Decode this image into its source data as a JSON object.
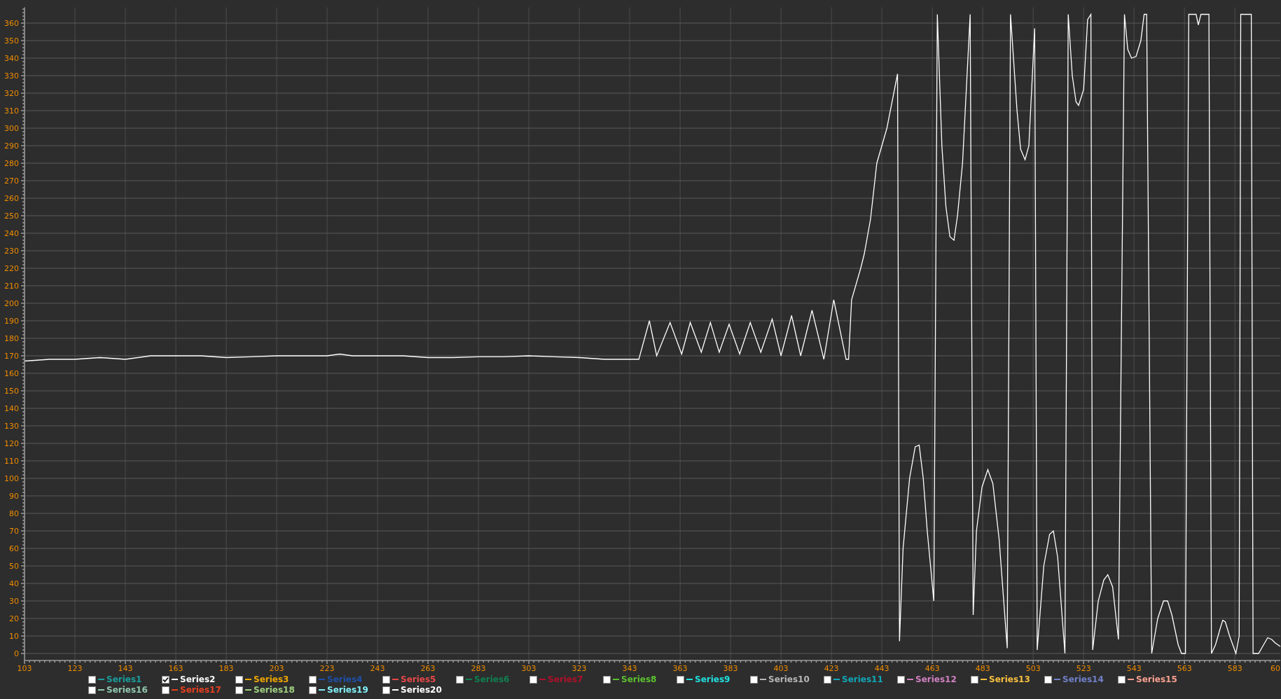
{
  "chart": {
    "chart_data": {
      "type": "line",
      "xlim": [
        103,
        601
      ],
      "grid": true,
      "ylim": [
        -4,
        369
      ],
      "xticks": [
        103,
        123,
        143,
        163,
        183,
        203,
        223,
        243,
        263,
        283,
        303,
        323,
        343,
        363,
        383,
        403,
        423,
        443,
        463,
        483,
        503,
        523,
        543,
        563,
        583
      ],
      "yticks": [
        0,
        10,
        20,
        30,
        40,
        50,
        60,
        70,
        80,
        90,
        100,
        110,
        120,
        130,
        140,
        150,
        160,
        170,
        180,
        190,
        200,
        210,
        220,
        230,
        240,
        250,
        260,
        270,
        280,
        290,
        300,
        310,
        320,
        330,
        340,
        350,
        360
      ],
      "x": [
        103,
        113,
        123,
        133,
        143,
        153,
        163,
        173,
        183,
        193,
        203,
        213,
        223,
        228,
        233,
        243,
        253,
        263,
        273,
        283,
        293,
        303,
        313,
        323,
        333,
        343,
        346.6,
        350.8,
        353.7,
        359,
        363.6,
        367,
        371.4,
        375,
        378.5,
        382.4,
        386.6,
        390.8,
        395,
        399.5,
        403,
        407.2,
        410.8,
        415.3,
        420,
        423.9,
        428.8,
        429.8,
        431,
        434.6,
        436,
        438.5,
        441,
        445,
        449.2,
        450,
        451.4,
        454,
        456.2,
        457.8,
        459.4,
        461,
        463.6,
        465,
        466.8,
        468.4,
        470,
        471.6,
        473,
        475,
        478,
        479.2,
        480.5,
        482.7,
        485,
        487,
        489.5,
        492.7,
        494,
        496.6,
        498,
        499.8,
        501.3,
        503.6,
        504.6,
        507.2,
        509.5,
        511,
        512.7,
        515.6,
        516.9,
        518.5,
        520,
        521,
        523,
        524.6,
        525.9,
        526.6,
        528.8,
        531,
        532.6,
        534.5,
        536.8,
        539.2,
        540.5,
        542,
        543.8,
        545.7,
        547,
        548,
        550,
        552.4,
        554.7,
        556.3,
        558,
        560.5,
        561.8,
        563.4,
        564.7,
        567.6,
        568.5,
        569.5,
        572.7,
        573.7,
        575.3,
        577.3,
        578.2,
        579.2,
        580.9,
        583.4,
        584.7,
        585.3,
        589.5,
        590.2,
        592.4,
        594.4,
        596,
        597.6,
        599,
        601
      ],
      "series": [
        {
          "name": "Series2",
          "color": "#ffffff",
          "values": [
            167,
            168,
            168,
            169,
            168,
            170,
            170,
            170,
            169,
            169.5,
            170,
            170,
            170,
            171,
            170,
            170,
            170,
            169,
            169,
            169.5,
            169.5,
            170,
            169.5,
            169,
            168,
            168,
            168,
            190,
            170,
            189,
            171,
            189,
            172,
            189,
            172,
            188,
            171,
            189,
            172,
            191,
            170,
            193,
            170,
            196,
            168,
            202,
            168,
            168,
            202,
            220,
            228,
            248,
            280,
            300,
            331,
            7,
            60,
            100,
            118,
            119,
            100,
            70,
            30,
            365,
            290,
            255,
            238,
            236,
            250,
            280,
            365,
            22,
            70,
            95,
            105,
            97,
            65,
            3,
            365,
            310,
            288,
            282,
            290,
            357,
            2,
            50,
            68,
            70,
            55,
            0,
            365,
            330,
            315,
            313,
            322,
            362,
            365,
            2,
            30,
            42,
            45,
            38,
            8,
            365,
            345,
            340,
            341,
            350,
            365,
            365,
            0,
            20,
            30,
            30,
            22,
            5,
            0,
            0,
            365,
            365,
            359,
            365,
            365,
            0,
            5,
            15,
            19,
            18,
            10,
            0,
            10,
            365,
            365,
            0,
            0,
            5,
            9,
            8,
            6,
            4
          ]
        }
      ]
    },
    "cut_tick_label": "60",
    "legend": [
      {
        "label": "Series1",
        "color": "#1a9e9e",
        "checked": false
      },
      {
        "kind": "plotted",
        "checked": true
      },
      {
        "label": "Series3",
        "color": "#f0a800",
        "checked": false
      },
      {
        "label": "Series4",
        "color": "#1f4fa8",
        "checked": false
      },
      {
        "label": "Series5",
        "color": "#e84848",
        "checked": false
      },
      {
        "label": "Series6",
        "color": "#108050",
        "checked": false
      },
      {
        "label": "Series7",
        "color": "#b0102a",
        "checked": false
      },
      {
        "label": "Series8",
        "color": "#5cc030",
        "checked": false
      },
      {
        "label": "Series9",
        "color": "#20e0e0",
        "checked": false
      },
      {
        "label": "Series10",
        "color": "#b8b8b8",
        "checked": false
      },
      {
        "label": "Series11",
        "color": "#10a8b8",
        "checked": false
      },
      {
        "label": "Series12",
        "color": "#d080c0",
        "checked": false
      },
      {
        "label": "Series13",
        "color": "#f8c040",
        "checked": false
      },
      {
        "label": "Series14",
        "color": "#7080c8",
        "checked": false
      },
      {
        "label": "Series15",
        "color": "#f8a090",
        "checked": false
      },
      {
        "label": "Series16",
        "color": "#90c8b0",
        "checked": false
      },
      {
        "label": "Series17",
        "color": "#e84020",
        "checked": false
      },
      {
        "label": "Series18",
        "color": "#a0d080",
        "checked": false
      },
      {
        "label": "Series19",
        "color": "#80f0f8",
        "checked": false
      },
      {
        "label": "Series20",
        "color": "#ffffff",
        "checked": false
      }
    ]
  }
}
